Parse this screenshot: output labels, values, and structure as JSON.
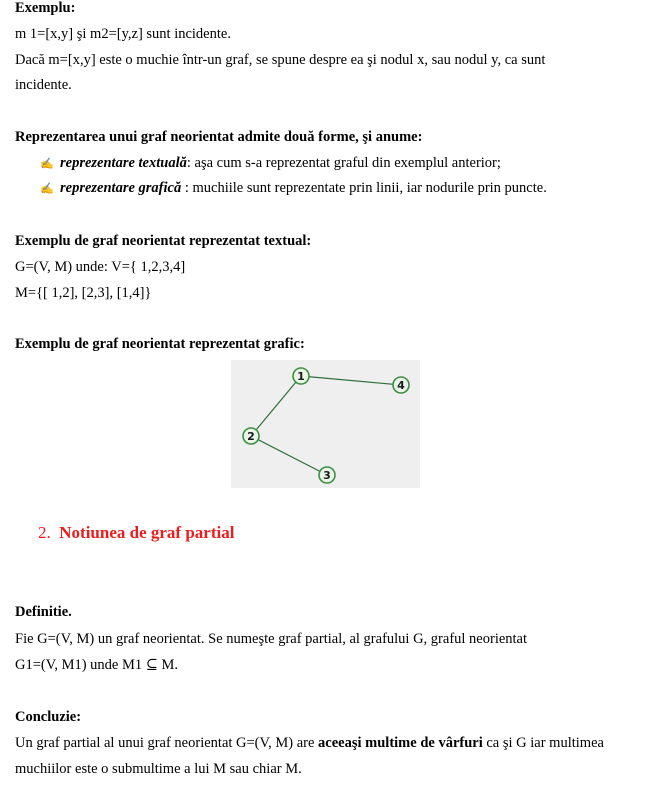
{
  "example": {
    "heading": "Exemplu:",
    "line1": "m 1=[x,y] şi m2=[y,z] sunt incidente.",
    "line2": "Dacă m=[x,y] este o muchie într-un graf, se spune despre ea şi nodul x, sau nodul y, ca sunt",
    "line3": "incidente."
  },
  "representation": {
    "heading": "Reprezentarea unui graf neorientat admite două forme, şi anume:",
    "bullet_icon": "pencil-icon",
    "bullet_glyph": "✍",
    "bullets": [
      {
        "term": "reprezentare textuală",
        "text": ": aşa cum s-a reprezentat graful din exemplul anterior;"
      },
      {
        "term": "reprezentare grafică",
        "text": " : muchiile sunt reprezentate prin linii, iar nodurile prin puncte."
      }
    ]
  },
  "textual_example": {
    "heading": "Exemplu de graf neorientat reprezentat textual:",
    "line1": "G=(V, M) unde: V={ 1,2,3,4]",
    "line2": "M={[ 1,2], [2,3], [1,4]}"
  },
  "graphical_example": {
    "heading": "Exemplu de graf neorientat reprezentat grafic:",
    "graph": {
      "nodes": [
        {
          "id": "1",
          "label": "1"
        },
        {
          "id": "2",
          "label": "2"
        },
        {
          "id": "3",
          "label": "3"
        },
        {
          "id": "4",
          "label": "4"
        }
      ],
      "edges": [
        [
          "1",
          "2"
        ],
        [
          "2",
          "3"
        ],
        [
          "1",
          "4"
        ]
      ],
      "edge_color": "#2f6f3a",
      "node_ring_color": "#3e8e41",
      "node_fill_color": "#e8f5e8",
      "background_color": "#efefef"
    }
  },
  "section": {
    "number": "2.",
    "title": "Notiunea de graf partial",
    "color": "#ee1c1c"
  },
  "definition": {
    "heading": "Definitie.",
    "line1": "Fie G=(V, M) un graf neorientat. Se numeşte graf partial, al grafului G, graful neorientat",
    "line2": "G1=(V, M1) unde M1 ⊆ M."
  },
  "conclusion": {
    "heading": "Concluzie:",
    "line1_part1": "Un graf partial al unui graf neorientat G=(V, M) are ",
    "line1_bold": "aceeaşi multime de vârfuri",
    "line1_part2": " ca şi G iar multimea",
    "line2": "muchiilor este o submultime a lui M sau chiar M."
  }
}
